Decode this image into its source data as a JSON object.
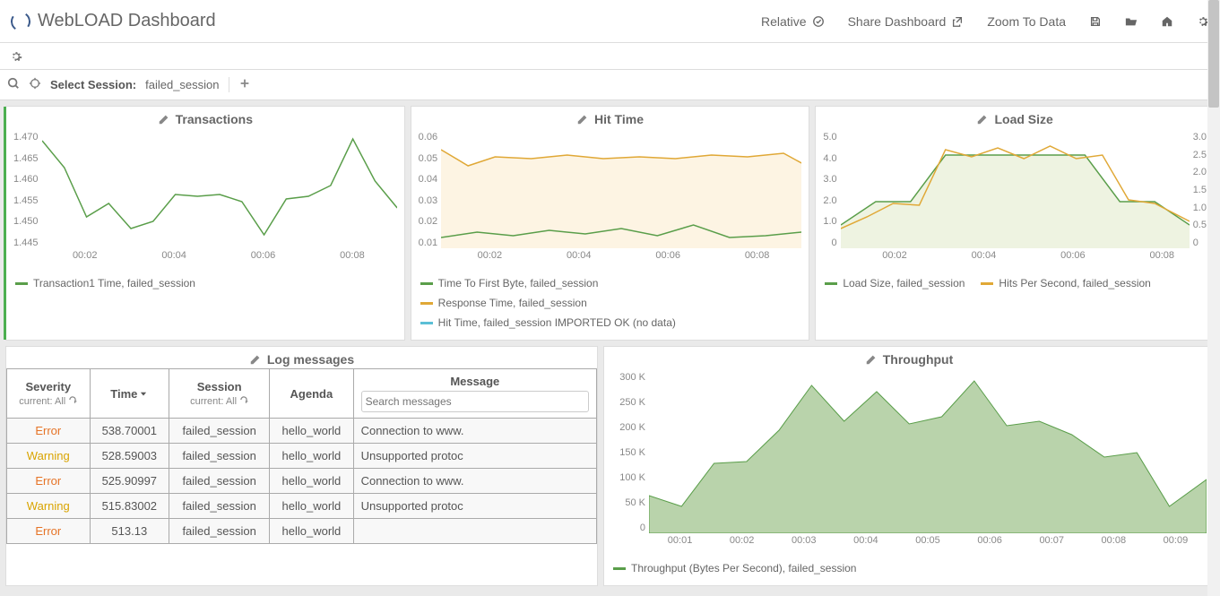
{
  "header": {
    "title": "WebLOAD Dashboard",
    "actions": {
      "relative": "Relative",
      "share": "Share Dashboard",
      "zoom": "Zoom To Data"
    }
  },
  "session_bar": {
    "label": "Select Session:",
    "value": "failed_session"
  },
  "panels": {
    "transactions": {
      "title": "Transactions",
      "y_ticks": [
        "1.470",
        "1.465",
        "1.460",
        "1.455",
        "1.450",
        "1.445"
      ],
      "x_ticks": [
        "00:02",
        "00:04",
        "00:06",
        "00:08"
      ],
      "legend": [
        {
          "label": "Transaction1 Time, failed_session",
          "color": "#5a9e4a"
        }
      ]
    },
    "hit_time": {
      "title": "Hit Time",
      "y_ticks": [
        "0.06",
        "0.05",
        "0.04",
        "0.03",
        "0.02",
        "0.01"
      ],
      "x_ticks": [
        "00:02",
        "00:04",
        "00:06",
        "00:08"
      ],
      "legend": [
        {
          "label": "Time To First Byte, failed_session",
          "color": "#5a9e4a"
        },
        {
          "label": "Response Time, failed_session",
          "color": "#e0a836"
        },
        {
          "label": "Hit Time, failed_session IMPORTED OK (no data)",
          "color": "#5bbfd6"
        }
      ]
    },
    "load_size": {
      "title": "Load Size",
      "y_ticks_left": [
        "5.0",
        "4.0",
        "3.0",
        "2.0",
        "1.0",
        "0"
      ],
      "y_ticks_right": [
        "3.0",
        "2.5",
        "2.0",
        "1.5",
        "1.0",
        "0.5",
        "0"
      ],
      "x_ticks": [
        "00:02",
        "00:04",
        "00:06",
        "00:08"
      ],
      "legend": [
        {
          "label": "Load Size, failed_session",
          "color": "#5a9e4a"
        },
        {
          "label": "Hits Per Second, failed_session",
          "color": "#e0a836"
        }
      ]
    },
    "log": {
      "title": "Log messages",
      "headers": {
        "severity": "Severity",
        "severity_sub": "current: All",
        "time": "Time",
        "session": "Session",
        "session_sub": "current: All",
        "agenda": "Agenda",
        "message": "Message",
        "message_placeholder": "Search messages"
      },
      "rows": [
        {
          "sev": "Error",
          "sev_class": "sev-error",
          "time": "538.70001",
          "session": "failed_session",
          "agenda": "hello_world",
          "msg": "Connection to www."
        },
        {
          "sev": "Warning",
          "sev_class": "sev-warning",
          "time": "528.59003",
          "session": "failed_session",
          "agenda": "hello_world",
          "msg": "Unsupported protoc"
        },
        {
          "sev": "Error",
          "sev_class": "sev-error",
          "time": "525.90997",
          "session": "failed_session",
          "agenda": "hello_world",
          "msg": "Connection to www."
        },
        {
          "sev": "Warning",
          "sev_class": "sev-warning",
          "time": "515.83002",
          "session": "failed_session",
          "agenda": "hello_world",
          "msg": "Unsupported protoc"
        },
        {
          "sev": "Error",
          "sev_class": "sev-error",
          "time": "513.13",
          "session": "failed_session",
          "agenda": "hello_world",
          "msg": ""
        }
      ]
    },
    "throughput": {
      "title": "Throughput",
      "y_ticks": [
        "300 K",
        "250 K",
        "200 K",
        "150 K",
        "100 K",
        "50 K",
        "0"
      ],
      "x_ticks": [
        "00:01",
        "00:02",
        "00:03",
        "00:04",
        "00:05",
        "00:06",
        "00:07",
        "00:08",
        "00:09"
      ],
      "legend": [
        {
          "label": "Throughput (Bytes Per Second), failed_session",
          "color": "#5a9e4a"
        }
      ]
    }
  },
  "chart_data": [
    {
      "type": "line",
      "title": "Transactions",
      "xlabel": "",
      "ylabel": "",
      "ylim": [
        1.445,
        1.47
      ],
      "x": [
        "00:01",
        "00:02",
        "00:03",
        "00:04",
        "00:05",
        "00:06",
        "00:07",
        "00:08",
        "00:09"
      ],
      "series": [
        {
          "name": "Transaction1 Time, failed_session",
          "values": [
            1.468,
            1.452,
            1.45,
            1.457,
            1.455,
            1.448,
            1.456,
            1.468,
            1.454
          ]
        }
      ]
    },
    {
      "type": "line",
      "title": "Hit Time",
      "xlabel": "",
      "ylabel": "",
      "ylim": [
        0.01,
        0.06
      ],
      "x": [
        "00:01",
        "00:02",
        "00:03",
        "00:04",
        "00:05",
        "00:06",
        "00:07",
        "00:08",
        "00:09"
      ],
      "series": [
        {
          "name": "Time To First Byte, failed_session",
          "values": [
            0.012,
            0.014,
            0.013,
            0.015,
            0.014,
            0.016,
            0.013,
            0.013,
            0.014
          ]
        },
        {
          "name": "Response Time, failed_session",
          "values": [
            0.053,
            0.046,
            0.049,
            0.05,
            0.048,
            0.05,
            0.049,
            0.05,
            0.047
          ]
        },
        {
          "name": "Hit Time, failed_session IMPORTED OK (no data)",
          "values": []
        }
      ]
    },
    {
      "type": "line",
      "title": "Load Size",
      "xlabel": "",
      "ylabel": "",
      "ylim": [
        0,
        5
      ],
      "ylim_right": [
        0,
        3
      ],
      "x": [
        "00:01",
        "00:02",
        "00:03",
        "00:04",
        "00:05",
        "00:06",
        "00:07",
        "00:08",
        "00:09"
      ],
      "series": [
        {
          "name": "Load Size, failed_session",
          "values": [
            1.0,
            2.0,
            2.0,
            4.0,
            4.0,
            4.0,
            4.0,
            2.0,
            1.0
          ]
        },
        {
          "name": "Hits Per Second, failed_session",
          "values": [
            0.6,
            1.2,
            1.2,
            2.6,
            2.5,
            2.7,
            2.5,
            1.2,
            0.7
          ]
        }
      ]
    },
    {
      "type": "area",
      "title": "Throughput",
      "xlabel": "",
      "ylabel": "Bytes Per Second",
      "ylim": [
        0,
        300000
      ],
      "x": [
        "00:01",
        "00:02",
        "00:03",
        "00:04",
        "00:05",
        "00:06",
        "00:07",
        "00:08",
        "00:09"
      ],
      "series": [
        {
          "name": "Throughput (Bytes Per Second), failed_session",
          "values": [
            70000,
            130000,
            280000,
            255000,
            220000,
            285000,
            205000,
            140000,
            100000
          ]
        }
      ]
    }
  ]
}
